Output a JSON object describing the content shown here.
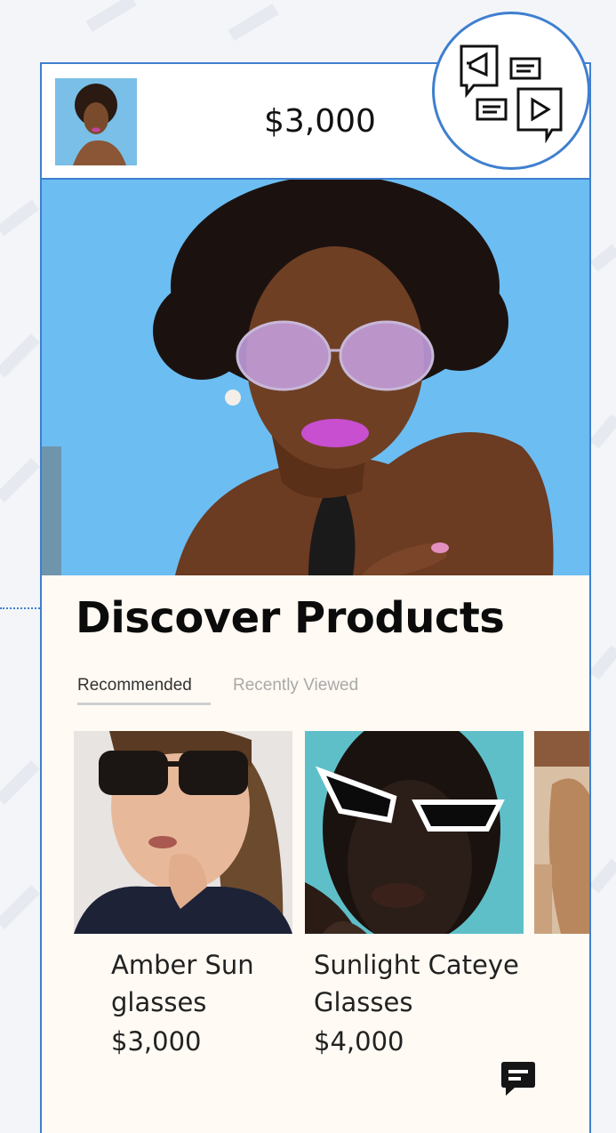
{
  "header": {
    "price": "$3,000"
  },
  "section": {
    "title": "Discover Products"
  },
  "tabs": [
    {
      "label": "Recommended",
      "active": true
    },
    {
      "label": "Recently Viewed",
      "active": false
    }
  ],
  "products": [
    {
      "name_line1": "Amber Sun",
      "name_line2": "glasses",
      "price": "$3,000"
    },
    {
      "name_line1": "Sunlight Cateye",
      "name_line2": "Glasses",
      "price": "$4,000"
    }
  ],
  "icons": {
    "campaign": "campaign-chat-icon",
    "chat": "chat-bubble-icon"
  },
  "colors": {
    "accent": "#3f7fcf",
    "sky": "#6fbdf2",
    "lips": "#c84fd0",
    "tab_inactive": "#a9a9a9"
  }
}
